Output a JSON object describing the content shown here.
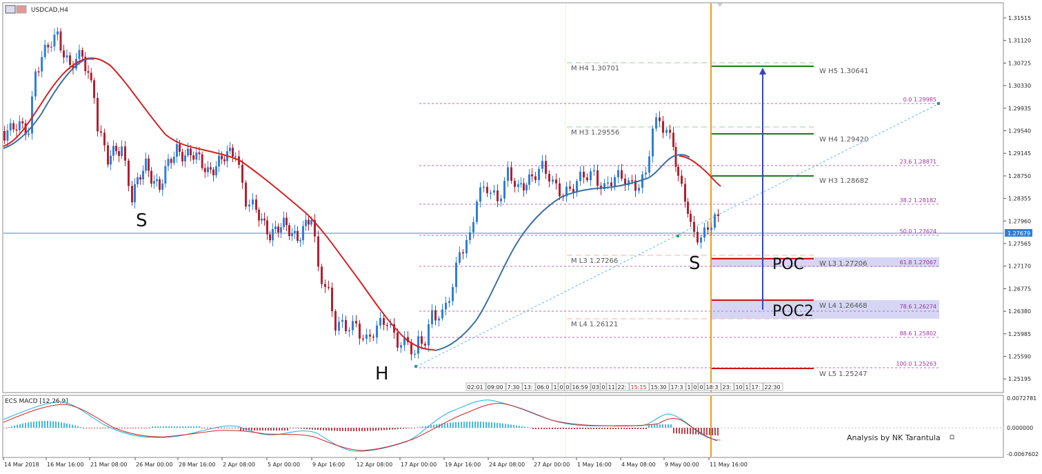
{
  "window": {
    "title": "USDCAD,H4"
  },
  "pattern_labels": {
    "left_shoulder": "S",
    "head": "H",
    "right_shoulder": "S"
  },
  "poc_labels": {
    "poc1": "POC",
    "poc2": "POC2"
  },
  "price_axis": {
    "ticks": [
      "1.31515",
      "1.31120",
      "1.30725",
      "1.30330",
      "1.29935",
      "1.29540",
      "1.29145",
      "1.28750",
      "1.28355",
      "1.27960",
      "1.27565",
      "1.27170",
      "1.26775",
      "1.26380",
      "1.25985",
      "1.25590",
      "1.25195"
    ],
    "current_price": "1.27679"
  },
  "monthly_levels": [
    {
      "label": "M  H4 1.30701"
    },
    {
      "label": "M  H3 1.29556"
    },
    {
      "label": "M  L3 1.27266"
    },
    {
      "label": "M  L4 1.26121"
    }
  ],
  "weekly_levels": [
    {
      "label": "W  H5 1.30641"
    },
    {
      "label": "W  H4 1.29420"
    },
    {
      "label": "W  H3 1.28682"
    },
    {
      "label": "W  L3 1.27206"
    },
    {
      "label": "W  L4 1.26468"
    },
    {
      "label": "W  L5 1.25247"
    }
  ],
  "fib_levels": [
    {
      "label": "0.0  1.29985"
    },
    {
      "label": "23.6  1.28871"
    },
    {
      "label": "38.2  1.28182"
    },
    {
      "label": "50.0  1.27624"
    },
    {
      "label": "61.8  1.27067"
    },
    {
      "label": "78.6  1.26274"
    },
    {
      "label": "88.6  1.25802"
    },
    {
      "label": "100.0  1.25263"
    }
  ],
  "session_labels": [
    "02:01",
    "09:00",
    "7:30",
    "13:",
    "06:0",
    "1",
    "0",
    "0",
    "16:59",
    "03",
    "0",
    "11",
    "22:",
    "15:15",
    "15:30",
    "17:3",
    "1",
    "0",
    "0",
    "18:3",
    "23:",
    "10",
    "1",
    "17:",
    "22:30"
  ],
  "indicator": {
    "title": "ECS MACD [12,26,9]",
    "ticks": [
      "0.0072781",
      "0.000000",
      "-0.0067602"
    ],
    "watermark": "Analysis by NK Tarantula"
  },
  "time_axis": [
    "14 Mar 2018",
    "16 Mar 16:00",
    "21 Mar 08:00",
    "26 Mar 00:00",
    "28 Mar 16:00",
    "2 Apr 08:00",
    "5 Apr 00:00",
    "9 Apr 16:00",
    "12 Apr 08:00",
    "17 Apr 00:00",
    "19 Apr 16:00",
    "24 Apr 08:00",
    "27 Apr 00:00",
    "1 May 16:00",
    "4 May 08:00",
    "9 May 00:00",
    "11 May 16:00"
  ],
  "colors": {
    "bull": "#2f7ed8",
    "bear": "#b22030",
    "ma_red": "#d42020",
    "ma_blue": "#3a6fa0",
    "fib": "#993399",
    "weekly_high": "#1a7a1a",
    "weekly_low": "#cc1111",
    "vline": "#e6a020",
    "arrow": "#3344cc",
    "macd_cyan": "#22aadd",
    "macd_red": "#cc2222"
  }
}
